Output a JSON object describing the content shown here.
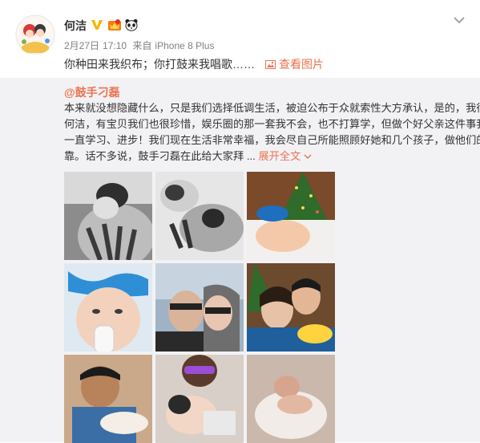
{
  "post": {
    "author": "何洁",
    "verified_badge_icon": "verified-v-icon",
    "vip_badge_icon": "vip-crown-icon",
    "panda_icon": "panda-icon",
    "date": "2月27日",
    "time": "17:10",
    "source_prefix": "来自",
    "source": "iPhone 8 Plus",
    "text": "你种田来我织布；你打鼓来我唱歌……",
    "view_pics_label": "查看图片",
    "menu_icon": "chevron-down-icon"
  },
  "repost": {
    "author": "@鼓手刁磊",
    "lines": [
      "本来就没想隐藏什么，只是我们选择低调生活，被迫公布于众就索性大方承认，是的，我很爱",
      "何洁，有宝贝我们也很珍惜，娱乐圈的那一套我不会，也不打算学，但做个好父亲这件事我会",
      "一直学习、进步！我们现在生活非常幸福，我会尽自己所能照顾好她和几个孩子，做他们的依",
      "靠。话不多说，鼓手刁磊在此给大家拜 ..."
    ],
    "expand_label": "展开全文"
  },
  "photos": [
    "photo-1",
    "photo-2",
    "photo-3",
    "photo-4",
    "photo-5",
    "photo-6",
    "photo-7",
    "photo-8",
    "photo-9"
  ],
  "colors": {
    "accent": "#eb7350",
    "muted": "#808080",
    "repost_bg": "#f2f2f5",
    "verified": "#f5b600"
  }
}
